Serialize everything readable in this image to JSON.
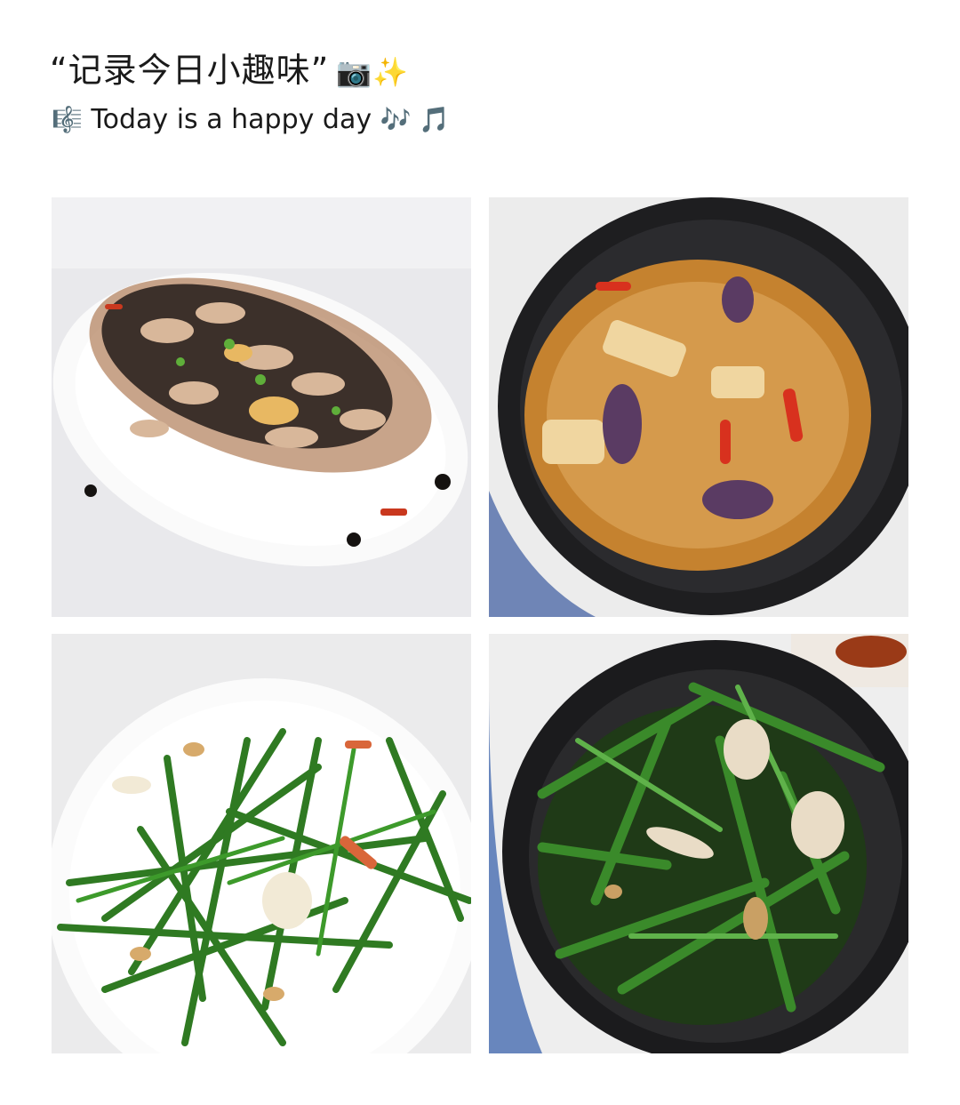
{
  "header": {
    "title": "“记录今日小趣味”",
    "title_emoji": "📷✨",
    "subtitle_icon": "🎼",
    "subtitle": "Today is a happy day",
    "subtitle_emoji": "🎶 🎵"
  },
  "photos": [
    {
      "icon": "photo-fish-black-bean"
    },
    {
      "icon": "photo-eggplant-clay-pot"
    },
    {
      "icon": "photo-chive-stir-fry"
    },
    {
      "icon": "photo-water-spinach-clay-pot"
    }
  ]
}
